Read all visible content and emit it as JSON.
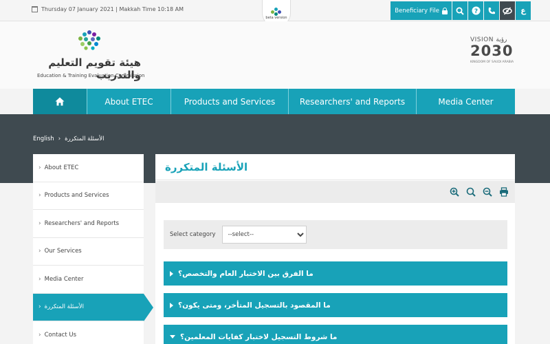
{
  "topbar": {
    "date": "Thursday 07 January 2021 | Makkah Time 10:18 AM",
    "beta_label": "beta version",
    "beneficiary_file": "Beneficiary File",
    "language_toggle": "ع",
    "icons": [
      "lock-icon",
      "search-icon",
      "help-icon",
      "phone-icon",
      "accessibility-icon"
    ]
  },
  "header": {
    "logo_arabic": "هيئة تقويم التعليم والتدريب",
    "logo_english": "Education & Training Evaluation Commission",
    "vision_arabic": "رؤية",
    "vision_label": "VISION",
    "vision_year": "2030",
    "vision_sub": "KINGDOM OF SAUDI ARABIA"
  },
  "nav": {
    "items": [
      "About ETEC",
      "Products and Services",
      "Researchers' and Reports",
      "Media Center"
    ]
  },
  "breadcrumb": {
    "home": "English",
    "separator": "›",
    "current": "الأسئلة المتكررة"
  },
  "sidebar": {
    "items": [
      {
        "label": "About ETEC"
      },
      {
        "label": "Products and Services"
      },
      {
        "label": "Researchers' and Reports"
      },
      {
        "label": "Our Services"
      },
      {
        "label": "Media Center"
      },
      {
        "label": "الأسئلة المتكررة"
      },
      {
        "label": "Contact Us"
      }
    ],
    "active_index": 5
  },
  "main": {
    "title": "الأسئلة المتكررة",
    "filter_label": "Select category",
    "select_value": "--select--",
    "faqs": [
      {
        "question": "ما الفرق بين الاختبار العام والتخصص؟"
      },
      {
        "question": "ما المقصود بالتسجيل المتأخر، ومتى يكون؟"
      },
      {
        "question": "ما شروط التسجيل لاختبار كفايات المعلمين؟"
      }
    ]
  },
  "colors": {
    "accent": "#18a2b8",
    "accent_dark": "#0f8a9c",
    "banner": "#3f4a50"
  }
}
